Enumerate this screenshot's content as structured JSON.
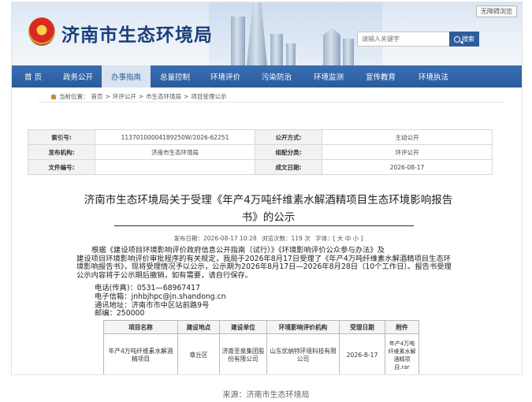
{
  "header": {
    "site_title": "济南市生态环境局",
    "barrier_free": "无障碍浏览",
    "search_placeholder": "请输入关键字",
    "search_button": "搜索"
  },
  "nav": {
    "items": [
      "首 页",
      "政务公开",
      "办事指南",
      "总量控制",
      "环境评价",
      "污染防治",
      "环境监测",
      "宣传教育",
      "环境执法"
    ],
    "active_index": 2
  },
  "breadcrumb": {
    "prefix": "当前位置：",
    "items": [
      "首页",
      "环评公开",
      "市生态环境局",
      "项目受理公示"
    ],
    "separator": " > "
  },
  "info_table": {
    "rows": [
      [
        {
          "label": "索引号:",
          "value": "11370100004189250W/2026-62251"
        },
        {
          "label": "公开方式:",
          "value": "主动公开"
        }
      ],
      [
        {
          "label": "发布机构:",
          "value": "济南市生态环境局"
        },
        {
          "label": "组配分类:",
          "value": "环评公开"
        }
      ],
      [
        {
          "label": "文件编号:",
          "value": ""
        },
        {
          "label": "成文日期:",
          "value": "2026-08-17"
        }
      ]
    ]
  },
  "article": {
    "title_line1": "济南市生态环境局关于受理《年产4万吨纤维素水解酒精项目生态环境影响报告",
    "title_line2": "书》的公示",
    "meta": {
      "publish": "发布日期：2026-08-17 10:28",
      "views": "浏览次数：119 次",
      "font_size": "字体：[ 大 中 小 ]"
    },
    "body_line1": "根据《建设项目环境影响评价政府信息公开指南（试行）》《环境影响评价公众参与办法》及",
    "body_rest": "建设项目环境影响评价审批程序的有关规定，我局于2026年8月17日受理了《年产4万吨纤维素水解酒精项目生态环境影响报告书》，现将受理情况予以公示，公示期为2026年8月17日—2026年8月28日（10个工作日）。报告书受理公示内容将于公示期后撤销，如有需要，请自行保存。",
    "contact": {
      "phone": "电话(传真)：0531—68967417",
      "email": "电子信箱：jnhbjhpc@jn.shandong.cn",
      "address": "通讯地址：济南市市中区站前路9号",
      "postcode": "邮编：250000"
    }
  },
  "project_table": {
    "headers": [
      "项目名称",
      "建设地点",
      "建设单位",
      "环境影响评价机构",
      "受理日期",
      "附件"
    ],
    "row": [
      "年产4万吨纤维素水解酒精项目",
      "章丘区",
      "济南圣泉集团股份有限公司",
      "山东优纳特环境科技有限公司",
      "2026-8-17",
      "年产4万吨纤维素水解酒精项目.rar"
    ]
  },
  "caption": "来源：济南市生态环境局"
}
